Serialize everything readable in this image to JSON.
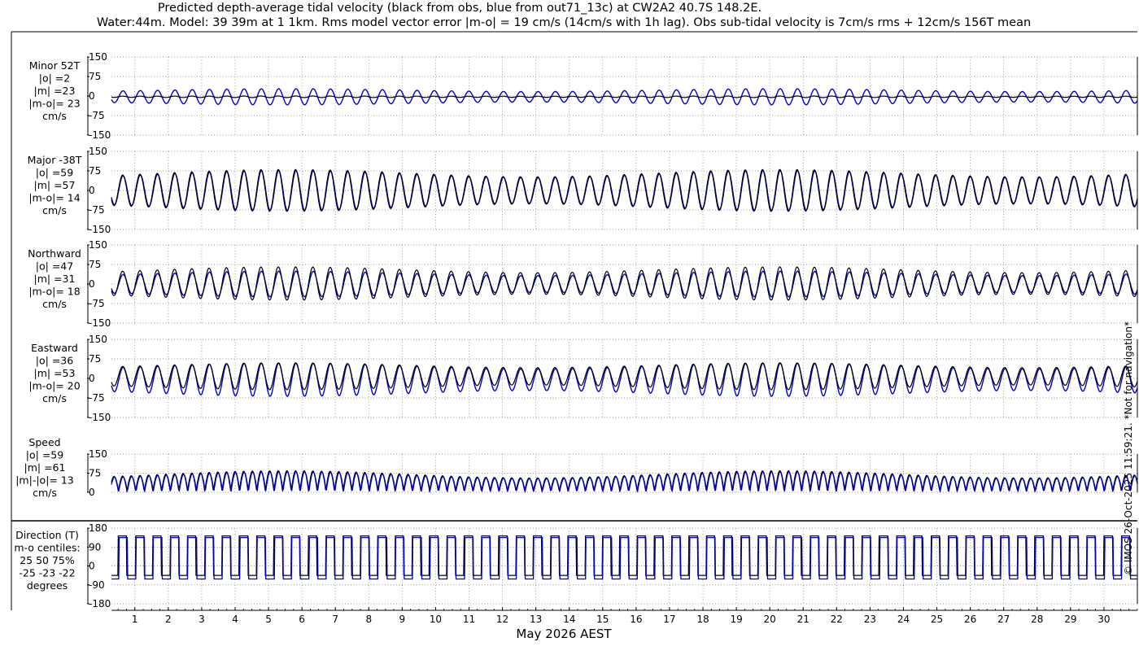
{
  "title_line1": "Predicted depth-average tidal velocity (black from obs, blue from out71_13c) at CW2A2 40.7S 148.2E.",
  "title_line2": "Water:44m. Model: 39 39m at 1 1km. Rms model vector error |m-o| = 19 cm/s (14cm/s with 1h lag). Obs sub-tidal velocity is 7cm/s rms + 12cm/s 156T mean",
  "watermark": "© IMOS 26-Oct-2025 11:59:21. *Not for navigation*",
  "colors": {
    "obs": "#000000",
    "model": "#0000cc"
  },
  "chart_data": {
    "type": "line",
    "xlabel": "May 2026 AEST",
    "x_ticks": [
      "1",
      "2",
      "3",
      "4",
      "5",
      "6",
      "7",
      "8",
      "9",
      "10",
      "11",
      "12",
      "13",
      "14",
      "15",
      "16",
      "17",
      "18",
      "19",
      "20",
      "21",
      "22",
      "23",
      "24",
      "25",
      "26",
      "27",
      "28",
      "29",
      "30"
    ],
    "xlim_days": [
      0.3,
      31
    ],
    "grid": true,
    "series": [
      {
        "name": "obs",
        "color": "#000000"
      },
      {
        "name": "model",
        "color": "#0000cc"
      }
    ],
    "panels": [
      {
        "id": "minor",
        "label": [
          "Minor 52T",
          "|o| =2",
          "|m| =23",
          "|m-o|= 23",
          "cm/s"
        ],
        "ylim": [
          -150,
          150
        ],
        "yticks": [
          "150",
          "75",
          "0",
          "-75",
          "-150"
        ],
        "obs_amplitude": 3,
        "model_amplitude": 30,
        "obs_offset": -3,
        "model_offset": -3
      },
      {
        "id": "major",
        "label": [
          "Major -38T",
          "|o| =59",
          "|m| =57",
          "|m-o|= 14",
          "cm/s"
        ],
        "ylim": [
          -150,
          150
        ],
        "yticks": [
          "150",
          "75",
          "0",
          "-75",
          "-150"
        ],
        "obs_amplitude": 78,
        "model_amplitude": 74,
        "obs_offset": 0,
        "model_offset": 0
      },
      {
        "id": "northward",
        "label": [
          "Northward",
          "|o| =47",
          "|m| =31",
          "|m-o|= 18",
          "cm/s"
        ],
        "ylim": [
          -150,
          150
        ],
        "yticks": [
          "150",
          "75",
          "0",
          "-75",
          "-150"
        ],
        "obs_amplitude": 62,
        "model_amplitude": 48,
        "obs_offset": 2,
        "model_offset": 0
      },
      {
        "id": "eastward",
        "label": [
          "Eastward",
          "|o| =36",
          "|m| =53",
          "|m-o|= 20",
          "cm/s"
        ],
        "ylim": [
          -150,
          150
        ],
        "yticks": [
          "150",
          "75",
          "0",
          "-75",
          "-150"
        ],
        "obs_amplitude": 50,
        "model_amplitude": 62,
        "obs_offset": 8,
        "model_offset": -5
      },
      {
        "id": "speed",
        "label": [
          "Speed",
          "|o| =59",
          "|m| =61",
          "|m|-|o|= 13",
          "cm/s"
        ],
        "ylim": [
          0,
          150
        ],
        "yticks": [
          "150",
          "75",
          "0"
        ],
        "obs_amplitude": 78,
        "model_amplitude": 74
      },
      {
        "id": "direction",
        "label": [
          "Direction (T)",
          "m-o centiles:",
          "25  50  75%",
          "-25 -23 -22",
          "degrees"
        ],
        "ylim": [
          -180,
          180
        ],
        "yticks": [
          "180",
          "90",
          "0",
          "-90",
          "-180"
        ],
        "obs_high": 143,
        "obs_low": -45,
        "model_high": 135,
        "model_low": -62
      }
    ]
  }
}
